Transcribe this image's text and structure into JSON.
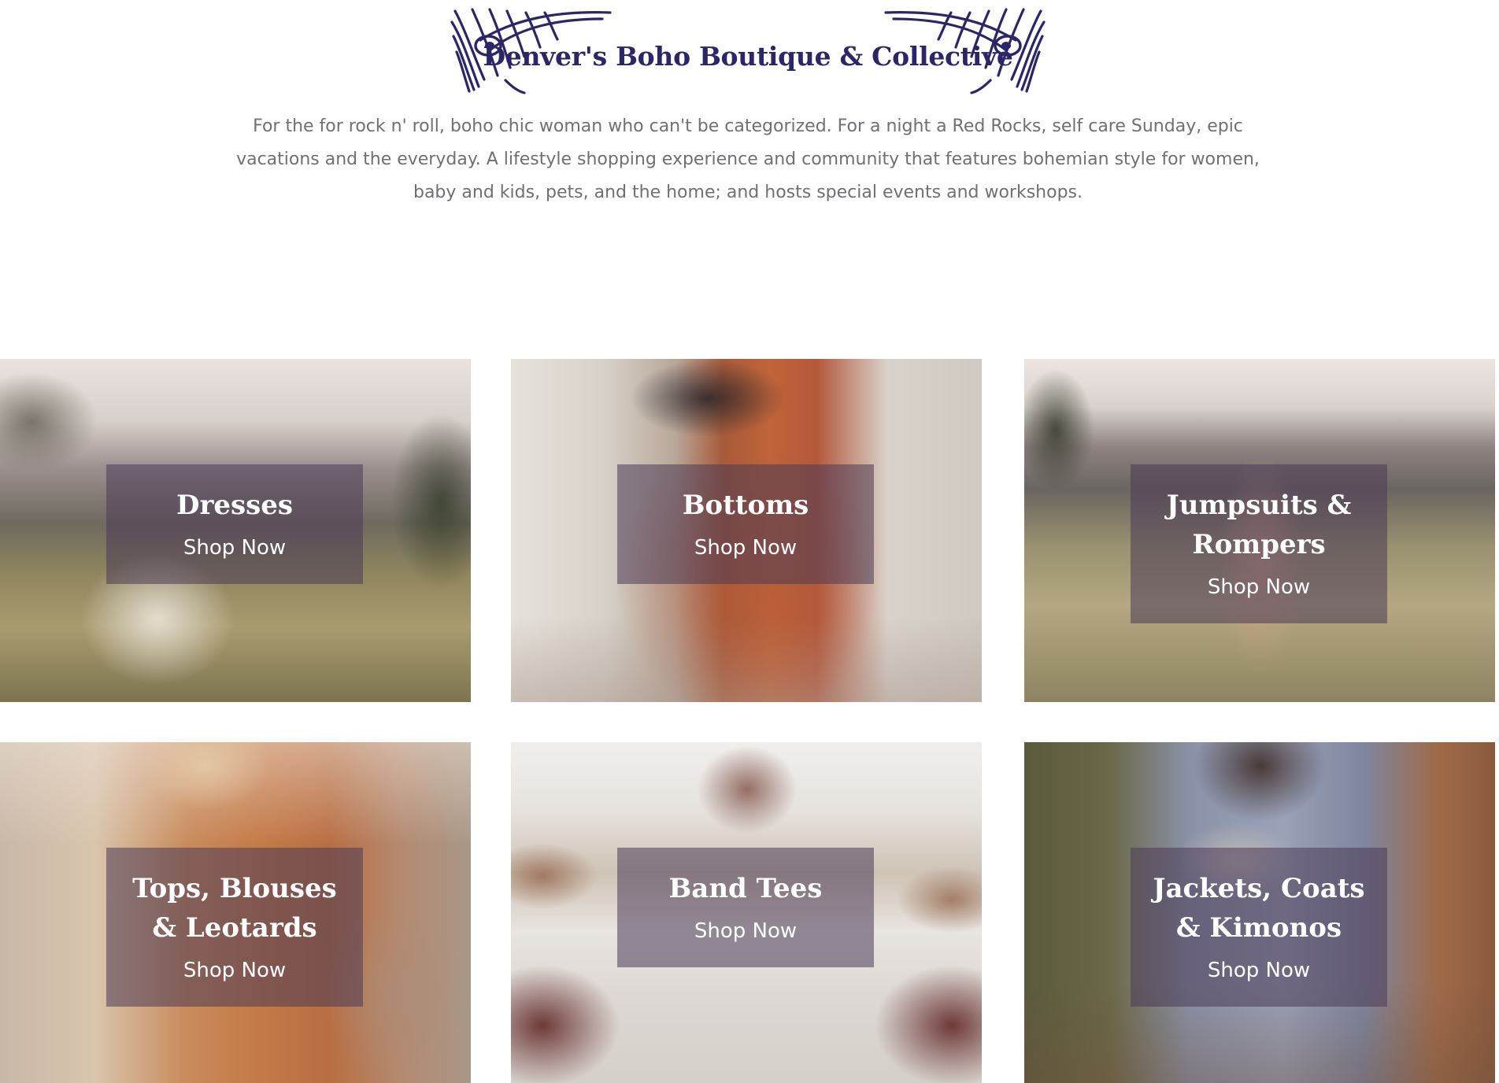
{
  "brand": {
    "name": "Denver's Boho Boutique & Collective",
    "colors": {
      "primary": "#2b2766",
      "overlay": "#4a3a56"
    }
  },
  "intro": {
    "text": "For the for rock n' roll, boho chic woman who can't be categorized. For a night a Red Rocks, self care Sunday, epic vacations and the everyday. A lifestyle shopping experience and community that features bohemian style for women, baby and kids, pets, and the home; and hosts special events and workshops."
  },
  "categories": [
    {
      "title": "Dresses",
      "cta": "Shop Now"
    },
    {
      "title": "Bottoms",
      "cta": "Shop Now"
    },
    {
      "title": "Jumpsuits & Rompers",
      "cta": "Shop Now"
    },
    {
      "title": "Tops, Blouses & Leotards",
      "cta": "Shop Now"
    },
    {
      "title": "Band Tees",
      "cta": "Shop Now"
    },
    {
      "title": "Jackets, Coats & Kimonos",
      "cta": "Shop Now"
    }
  ]
}
